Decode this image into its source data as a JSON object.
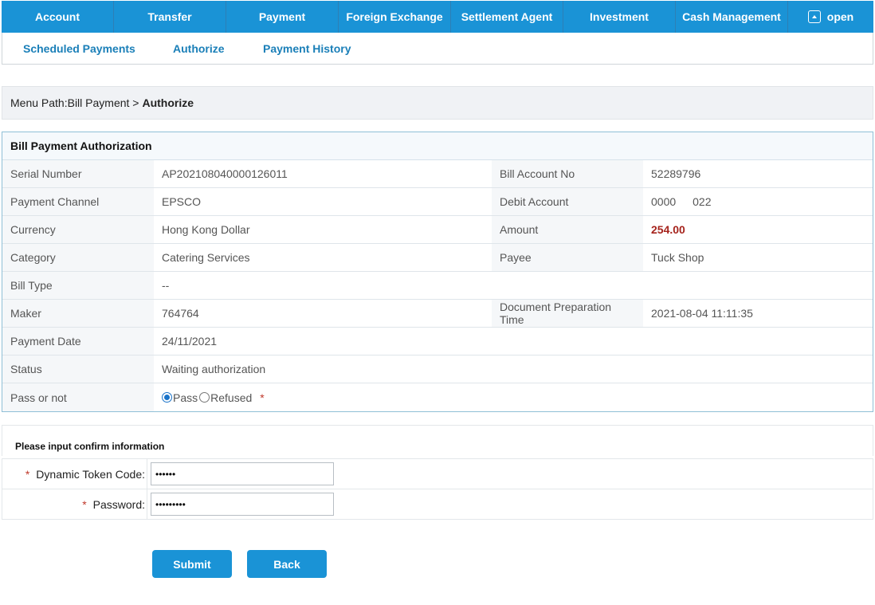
{
  "topnav": {
    "items": [
      {
        "label": "Account"
      },
      {
        "label": "Transfer"
      },
      {
        "label": "Payment"
      },
      {
        "label": "Foreign Exchange"
      },
      {
        "label": "Settlement Agent"
      },
      {
        "label": "Investment"
      },
      {
        "label": "Cash Management"
      },
      {
        "label": "open",
        "icon": "open-icon"
      }
    ]
  },
  "subnav": {
    "items": [
      {
        "label": "Scheduled Payments"
      },
      {
        "label": "Authorize"
      },
      {
        "label": "Payment History"
      }
    ]
  },
  "breadcrumb": {
    "prefix": "Menu Path:Bill Payment >",
    "current": "Authorize"
  },
  "detail": {
    "title": "Bill Payment Authorization",
    "rows": [
      {
        "l1": "Serial Number",
        "v1": "AP202108040000126011",
        "l2": "Bill Account No",
        "v2": "52289796"
      },
      {
        "l1": "Payment Channel",
        "v1": "EPSCO",
        "l2": "Debit Account",
        "v2": "0000   022"
      },
      {
        "l1": "Currency",
        "v1": "Hong Kong Dollar",
        "l2": "Amount",
        "v2": "254.00"
      },
      {
        "l1": "Category",
        "v1": "Catering Services",
        "l2": "Payee",
        "v2": "Tuck Shop"
      },
      {
        "l1": "Bill Type",
        "v1": "--",
        "l2": "",
        "v2": ""
      },
      {
        "l1": "Maker",
        "v1": "764764",
        "l2": "Document Preparation Time",
        "v2": "2021-08-04 11:11:35"
      },
      {
        "l1": "Payment Date",
        "v1": "24/11/2021",
        "l2": "",
        "v2": ""
      },
      {
        "l1": "Status",
        "v1": "Waiting authorization",
        "l2": "",
        "v2": ""
      }
    ],
    "pass": {
      "label": "Pass or not",
      "option_pass": "Pass",
      "option_refused": "Refused",
      "selected": "Pass",
      "required_mark": "*"
    },
    "amount_color": "#a6241d"
  },
  "confirm": {
    "heading": "Please input confirm information",
    "token_label": "Dynamic Token Code:",
    "token_value": "••••••",
    "password_label": "Password:",
    "password_value": "•••••••••",
    "required_mark": "*"
  },
  "buttons": {
    "submit": "Submit",
    "back": "Back"
  },
  "colors": {
    "accent": "#1a93d6",
    "link": "#1a7fb8"
  }
}
